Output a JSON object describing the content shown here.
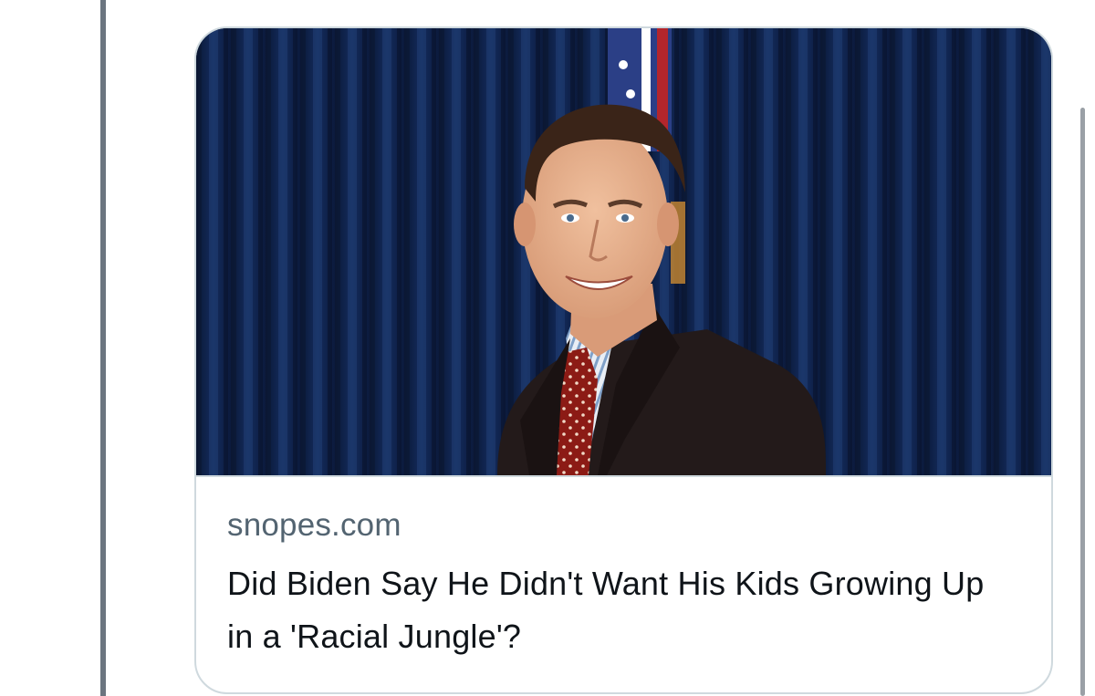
{
  "link_card": {
    "domain": "snopes.com",
    "title": "Did Biden Say He Didn't Want His Kids Growing Up in a 'Racial Jungle'?",
    "image_icon": "portrait-photo-icon"
  },
  "colors": {
    "background": "#ffffff",
    "thread_line": "#6b7580",
    "card_border": "#cfd9de",
    "domain_text": "#536471",
    "title_text": "#0f1419",
    "curtain": "#0c1c3d"
  }
}
